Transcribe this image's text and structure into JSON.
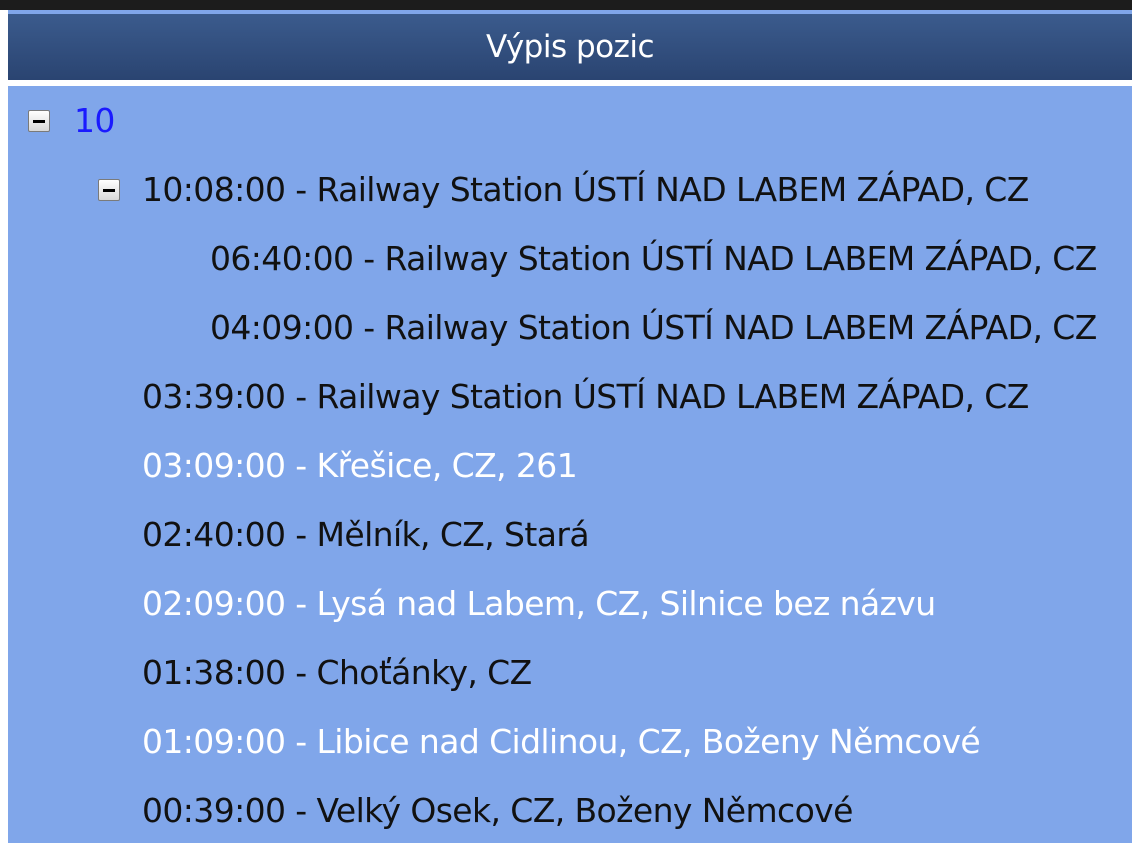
{
  "panel": {
    "title": "Výpis pozic"
  },
  "tree": {
    "root": {
      "label": "10",
      "toggle_icon": "collapse-icon",
      "child": {
        "label": "10:08:00 - Railway Station ÚSTÍ NAD LABEM ZÁPAD, CZ",
        "toggle_icon": "collapse-icon",
        "children": [
          "06:40:00 - Railway Station ÚSTÍ NAD LABEM ZÁPAD, CZ",
          "04:09:00 - Railway Station ÚSTÍ NAD LABEM ZÁPAD, CZ"
        ]
      }
    },
    "entries": [
      {
        "text": "03:39:00 - Railway Station ÚSTÍ NAD LABEM ZÁPAD, CZ",
        "highlighted": false
      },
      {
        "text": "03:09:00 - Křešice, CZ, 261",
        "highlighted": true
      },
      {
        "text": "02:40:00 - Mělník, CZ, Stará",
        "highlighted": false
      },
      {
        "text": "02:09:00 - Lysá nad Labem, CZ, Silnice bez názvu",
        "highlighted": true
      },
      {
        "text": "01:38:00 - Choťánky, CZ",
        "highlighted": false
      },
      {
        "text": "01:09:00 - Libice nad Cidlinou, CZ, Boženy Němcové",
        "highlighted": true
      },
      {
        "text": "00:39:00 - Velký Osek, CZ, Boženy Němcové",
        "highlighted": false
      }
    ]
  },
  "colors": {
    "panel_background": "#80a6ea",
    "header_background": "#2a4471",
    "root_text": "#1a1aff",
    "highlight_text": "#ffffff",
    "normal_text": "#111111"
  }
}
